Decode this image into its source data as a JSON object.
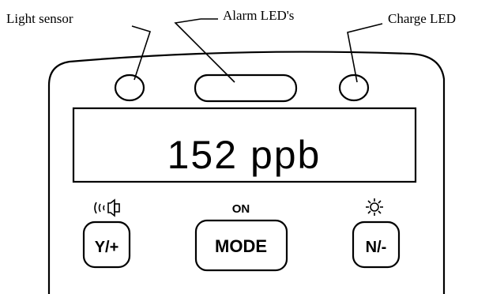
{
  "labels": {
    "light_sensor": "Light sensor",
    "alarm_leds": "Alarm LED's",
    "charge_led": "Charge LED"
  },
  "display": {
    "reading": "152 ppb"
  },
  "buttons": {
    "yes_plus": "Y/+",
    "mode": "MODE",
    "no_minus": "N/-"
  },
  "button_captions": {
    "mode_caption": "ON"
  },
  "icons": {
    "audio": "speaker-sound-icon",
    "backlight": "sun-icon"
  }
}
